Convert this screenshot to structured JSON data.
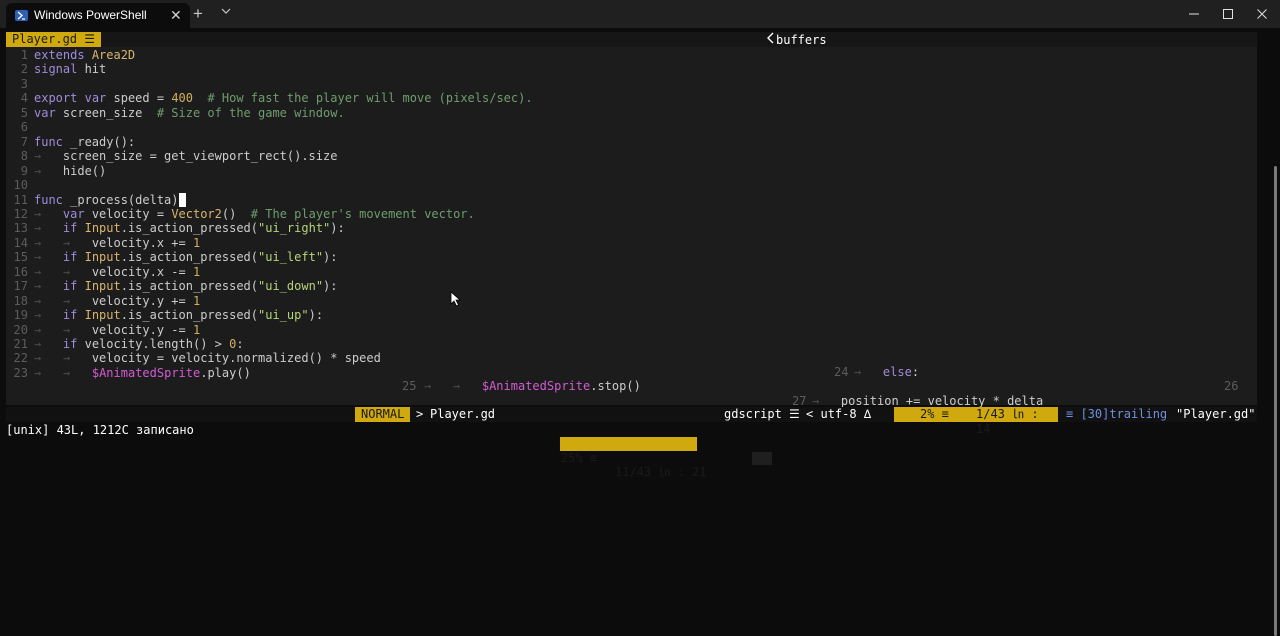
{
  "window": {
    "tab_title": "Windows PowerShell",
    "close_tab_glyph": "✕",
    "new_tab_glyph": "+",
    "icons": [
      "powershell-icon",
      "chevron-down-icon",
      "minimize-icon",
      "maximize-icon",
      "close-icon"
    ]
  },
  "bufferline": {
    "active_buffer": "Player.gd ☰",
    "buffers_label": "buffers"
  },
  "code_lines": [
    {
      "n": "1",
      "t": "extends Area2D"
    },
    {
      "n": "2",
      "t": "signal hit"
    },
    {
      "n": "3",
      "t": ""
    },
    {
      "n": "4",
      "t": "export var speed = 400  # How fast the player will move (pixels/sec)."
    },
    {
      "n": "5",
      "t": "var screen_size  # Size of the game window."
    },
    {
      "n": "6",
      "t": ""
    },
    {
      "n": "7",
      "t": "func _ready():"
    },
    {
      "n": "8",
      "t": "→   screen_size = get_viewport_rect().size"
    },
    {
      "n": "9",
      "t": "→   hide()"
    },
    {
      "n": "10",
      "t": ""
    },
    {
      "n": "11",
      "t": "func _process(delta)"
    },
    {
      "n": "12",
      "t": "→   var velocity = Vector2()  # The player's movement vector."
    },
    {
      "n": "13",
      "t": "→   if Input.is_action_pressed(\"ui_right\"):"
    },
    {
      "n": "14",
      "t": "→   →   velocity.x += 1"
    },
    {
      "n": "15",
      "t": "→   if Input.is_action_pressed(\"ui_left\"):"
    },
    {
      "n": "16",
      "t": "→   →   velocity.x -= 1"
    },
    {
      "n": "17",
      "t": "→   if Input.is_action_pressed(\"ui_down\"):"
    },
    {
      "n": "18",
      "t": "→   →   velocity.y += 1"
    },
    {
      "n": "19",
      "t": "→   if Input.is_action_pressed(\"ui_up\"):"
    },
    {
      "n": "20",
      "t": "→   →   velocity.y -= 1"
    },
    {
      "n": "21",
      "t": "→   if velocity.length() > 0:"
    },
    {
      "n": "22",
      "t": "→   →   velocity = velocity.normalized() * speed"
    },
    {
      "n": "23",
      "t": "→   →   $AnimatedSprite.play()"
    }
  ],
  "floating": {
    "line24_num": "24",
    "line24_text": "→   else:",
    "line25_num": "25",
    "line25_text": "→   →   $AnimatedSprite.stop()",
    "line26_num": "26",
    "line27_num": "27",
    "line27_text": "→   position += velocity * delta"
  },
  "statusline": {
    "mode": "NORMAL",
    "separator": ">",
    "file": "Player.gd",
    "filetype": "gdscript ☰",
    "filetype_sep": "<",
    "encoding": "utf-8 ∆",
    "percent": "2% ≡",
    "position": "1/43 ㏑ : 14",
    "trailing": "≡ [30]trailing",
    "filename_quoted": "\"Player.gd\""
  },
  "cmdline": {
    "message": "[unix] 43L, 1212C записано"
  },
  "ruler": {
    "percent": "25% ≡",
    "position": "11/43 ㏑ : 21"
  }
}
